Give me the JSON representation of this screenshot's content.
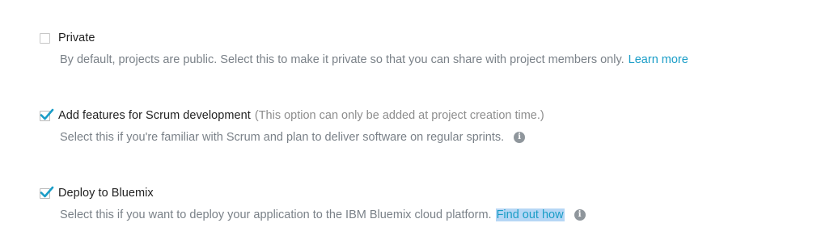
{
  "options": [
    {
      "label": "Private",
      "checked": false,
      "description": "By default, projects are public. Select this to make it private so that you can share with project members only.",
      "link_text": "Learn more"
    },
    {
      "label": "Add features for Scrum development",
      "note": "(This option can only be added at project creation time.)",
      "checked": true,
      "description": "Select this if you're familiar with Scrum and plan to deliver software on regular sprints.",
      "info_icon": "i"
    },
    {
      "label": "Deploy to Bluemix",
      "checked": true,
      "description": "Select this if you want to deploy your application to the IBM Bluemix cloud platform.",
      "link_text": "Find out how",
      "info_icon": "i"
    }
  ],
  "colors": {
    "link": "#1a9dc7",
    "checkmark": "#1a9dc7",
    "link_highlight": "#b6d7f5",
    "description": "#7a8188",
    "label": "#222222",
    "note": "#8d8d8d",
    "info_icon_bg": "#8f969c"
  }
}
